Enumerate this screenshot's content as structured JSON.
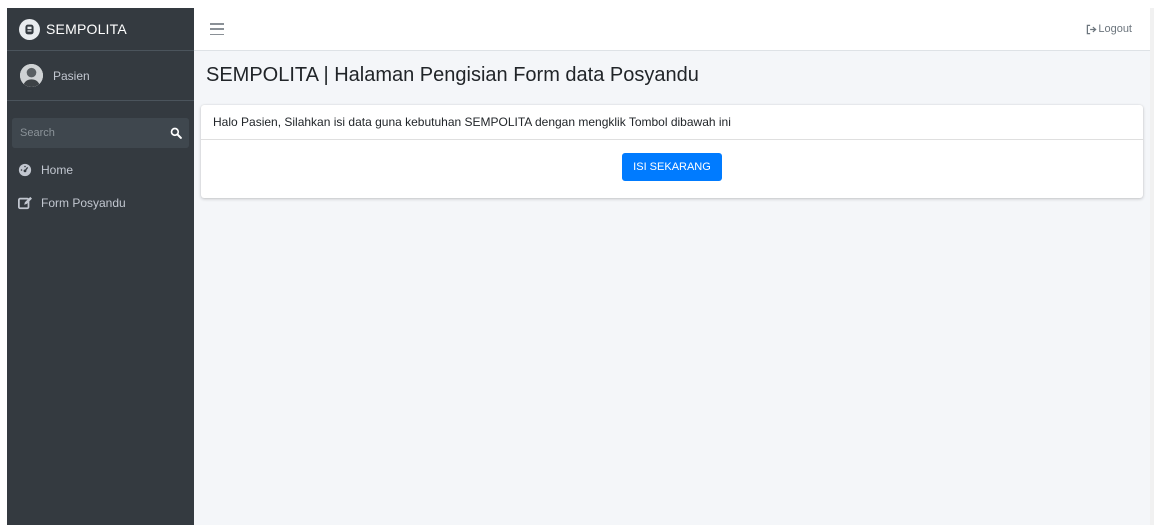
{
  "brand": {
    "name": "SEMPOLITA",
    "logo_icon": "brand-logo-icon"
  },
  "user": {
    "name": "Pasien",
    "avatar_icon": "user-avatar"
  },
  "search": {
    "placeholder": "Search",
    "icon": "search-icon"
  },
  "sidebar": {
    "items": [
      {
        "label": "Home",
        "icon": "tachometer-icon"
      },
      {
        "label": "Form Posyandu",
        "icon": "edit-icon"
      }
    ]
  },
  "topbar": {
    "menu_icon": "hamburger-icon",
    "logout_label": "Logout",
    "logout_icon": "sign-out-icon"
  },
  "main": {
    "title": "SEMPOLITA | Halaman Pengisian Form data Posyandu",
    "card": {
      "header_text": "Halo Pasien, Silahkan isi data guna kebutuhan SEMPOLITA dengan mengklik Tombol dibawah ini",
      "button_label": "ISI SEKARANG"
    }
  },
  "colors": {
    "sidebar_bg": "#343a40",
    "content_bg": "#f4f6f9",
    "primary": "#007bff"
  }
}
